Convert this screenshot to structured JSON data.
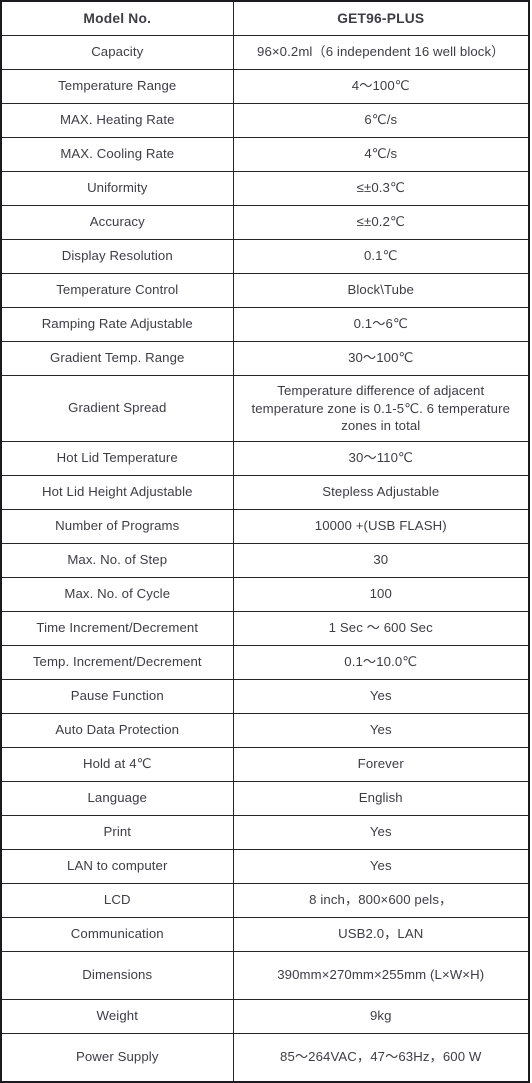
{
  "table": {
    "header": {
      "label": "Model No.",
      "value": "GET96-PLUS"
    },
    "rows": [
      {
        "label": "Capacity",
        "value": "96×0.2ml（6 independent 16 well block）",
        "size": "std"
      },
      {
        "label": "Temperature Range",
        "value": "4～100℃",
        "size": "std"
      },
      {
        "label": "MAX. Heating Rate",
        "value": "6℃/s",
        "size": "std"
      },
      {
        "label": "MAX. Cooling Rate",
        "value": "4℃/s",
        "size": "std"
      },
      {
        "label": "Uniformity",
        "value": "≤±0.3℃",
        "size": "std"
      },
      {
        "label": "Accuracy",
        "value": "≤±0.2℃",
        "size": "std"
      },
      {
        "label": "Display Resolution",
        "value": "0.1℃",
        "size": "std"
      },
      {
        "label": "Temperature Control",
        "value": "Block\\Tube",
        "size": "std"
      },
      {
        "label": "Ramping Rate Adjustable",
        "value": "0.1～6℃",
        "size": "std"
      },
      {
        "label": "Gradient Temp. Range",
        "value": "30～100℃",
        "size": "std"
      },
      {
        "label": "Gradient Spread",
        "value": "Temperature difference of adjacent temperature zone is 0.1-5℃. 6 temperature zones in total",
        "size": "xtall"
      },
      {
        "label": "Hot Lid Temperature",
        "value": "30～110℃",
        "size": "std"
      },
      {
        "label": "Hot Lid Height Adjustable",
        "value": "Stepless Adjustable",
        "size": "std"
      },
      {
        "label": "Number of Programs",
        "value": "10000 +(USB FLASH)",
        "size": "std"
      },
      {
        "label": "Max. No. of Step",
        "value": "30",
        "size": "std"
      },
      {
        "label": "Max. No. of Cycle",
        "value": "100",
        "size": "std"
      },
      {
        "label": "Time Increment/Decrement",
        "value": "1 Sec ～ 600 Sec",
        "size": "std"
      },
      {
        "label": "Temp. Increment/Decrement",
        "value": "0.1～10.0℃",
        "size": "std"
      },
      {
        "label": "Pause Function",
        "value": "Yes",
        "size": "std"
      },
      {
        "label": "Auto Data Protection",
        "value": "Yes",
        "size": "std"
      },
      {
        "label": "Hold at 4℃",
        "value": "Forever",
        "size": "std"
      },
      {
        "label": "Language",
        "value": "English",
        "size": "std"
      },
      {
        "label": "Print",
        "value": "Yes",
        "size": "std"
      },
      {
        "label": "LAN to computer",
        "value": "Yes",
        "size": "std"
      },
      {
        "label": "LCD",
        "value": "8 inch，800×600 pels，",
        "size": "std"
      },
      {
        "label": "Communication",
        "value": "USB2.0，LAN",
        "size": "std"
      },
      {
        "label": "Dimensions",
        "value": "390mm×270mm×255mm (L×W×H)",
        "size": "tall"
      },
      {
        "label": "Weight",
        "value": "9kg",
        "size": "std"
      },
      {
        "label": "Power Supply",
        "value": "85～264VAC，47～63Hz，600 W",
        "size": "tall"
      }
    ]
  }
}
